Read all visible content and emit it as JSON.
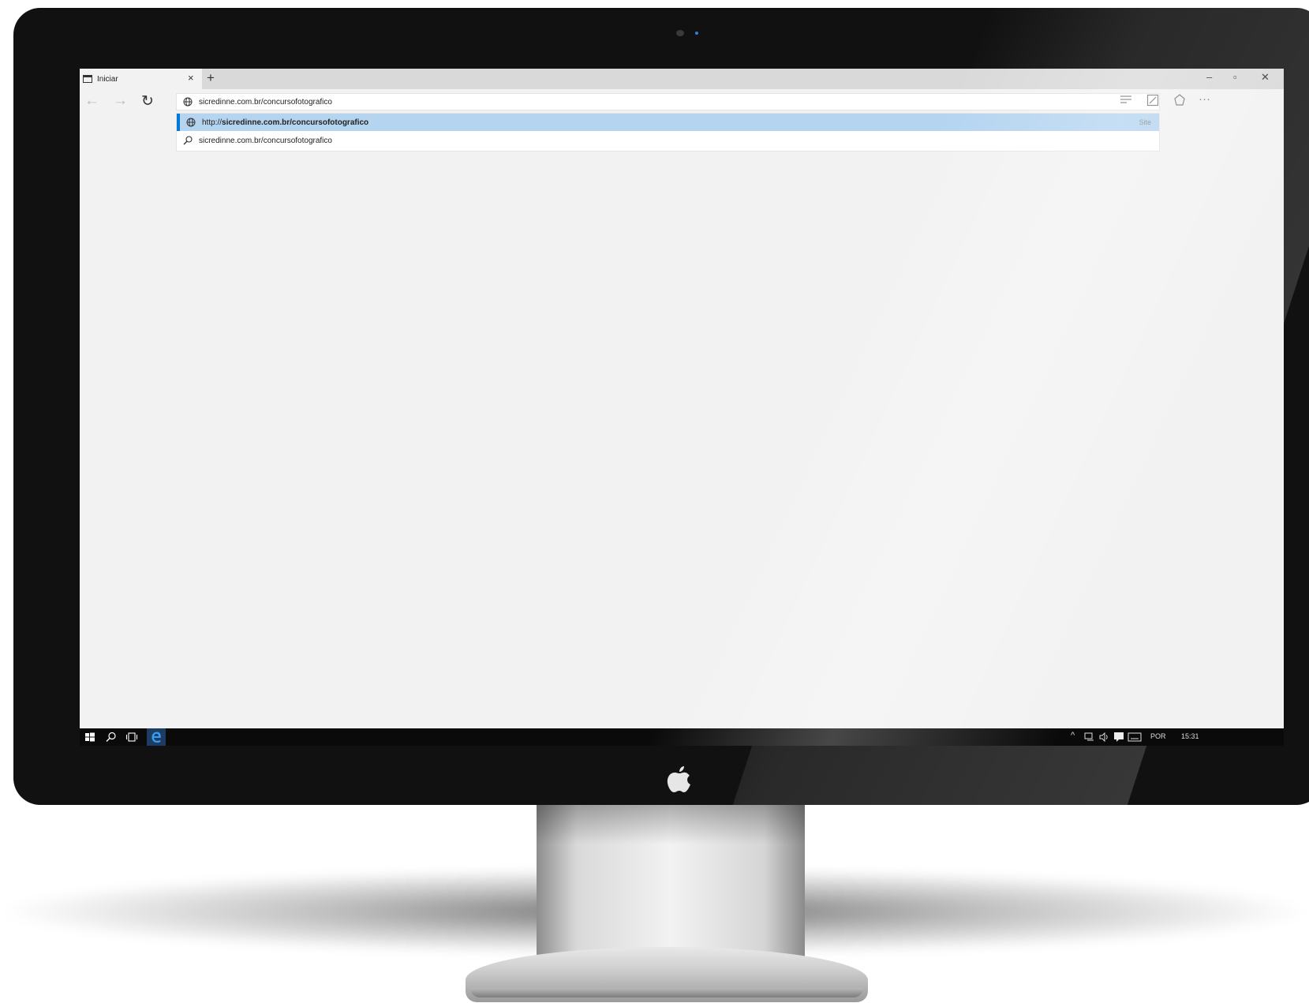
{
  "browser": {
    "tab": {
      "title": "Iniciar",
      "close_glyph": "×",
      "icon": "tab-page-icon"
    },
    "new_tab_glyph": "+",
    "window_controls": {
      "minimize": "–",
      "maximize": "▫",
      "close": "✕"
    },
    "nav": {
      "back": "←",
      "forward": "→",
      "refresh": "↻"
    },
    "address_bar": {
      "value": "sicredinne.com.br/concursofotografico",
      "icon": "globe-icon"
    },
    "toolbar_icons": [
      "reading-view-icon",
      "web-note-icon",
      "share-icon",
      "more-icon"
    ],
    "more_glyph": "···",
    "suggestions": [
      {
        "prefix": "http://",
        "bold": "sicredinne.com.br/concursofotografico",
        "tag": "Site",
        "icon": "globe-icon",
        "selected": true
      },
      {
        "prefix": "",
        "bold": "",
        "text": "sicredinne.com.br/concursofotografico",
        "tag": "",
        "icon": "search-icon",
        "selected": false
      }
    ]
  },
  "taskbar": {
    "icons": [
      "windows-start-icon",
      "search-icon",
      "task-view-icon",
      "edge-icon"
    ],
    "tray": {
      "language": "POR",
      "time": "15:31",
      "chevron": "^"
    }
  },
  "colors": {
    "selection": "#b4d4f0",
    "accent": "#0078d7",
    "bezel": "#111111",
    "taskbar": "#0a0a0a"
  }
}
